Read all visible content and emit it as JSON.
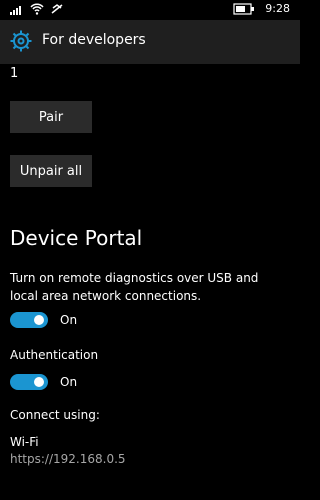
{
  "statusbar": {
    "time": "9:28"
  },
  "header": {
    "title": "For developers",
    "gear_icon": "gear-icon"
  },
  "content": {
    "count": "1",
    "pair_label": "Pair",
    "unpair_label": "Unpair all",
    "section_title": "Device Portal",
    "description": "Turn on remote diagnostics over USB and local area network connections.",
    "toggle1_label": "On",
    "auth_label": "Authentication",
    "toggle2_label": "On",
    "connect_label": "Connect using:",
    "wifi_label": "Wi-Fi",
    "url": "https://192.168.0.5"
  },
  "colors": {
    "accent": "#1b95d1",
    "background": "#000000",
    "titlebar": "#1f1f1f",
    "button": "#2b2b2b"
  }
}
